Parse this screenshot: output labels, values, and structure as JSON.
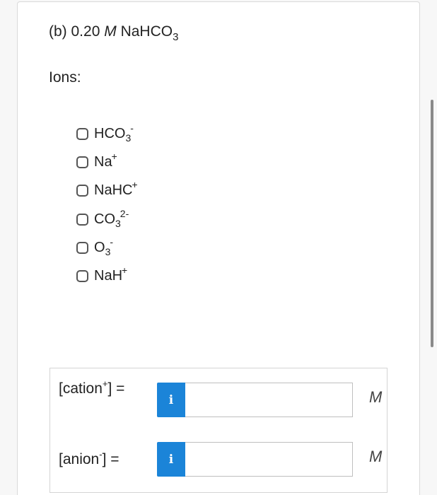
{
  "question": {
    "prefix": "(b) 0.20",
    "molar_symbol": "M",
    "compound": {
      "main": "NaHCO",
      "subscript": "3"
    }
  },
  "ions_heading": "Ions:",
  "options": [
    {
      "main": "HCO",
      "sub": "3",
      "sup": "-"
    },
    {
      "main": "Na",
      "sub": "",
      "sup": "+"
    },
    {
      "main": "NaHC",
      "sub": "",
      "sup": "+"
    },
    {
      "main": "CO",
      "sub": "3",
      "sup": "2-"
    },
    {
      "main": "O",
      "sub": "3",
      "sup": "-"
    },
    {
      "main": "NaH",
      "sub": "",
      "sup": "+"
    }
  ],
  "answers": {
    "cation": {
      "label_before": "[cation",
      "label_sup": "+",
      "label_after": "] =",
      "info_icon": "i",
      "value": "",
      "unit": "M"
    },
    "anion": {
      "label_before": "[anion",
      "label_sup": "-",
      "label_after": "] =",
      "info_icon": "i",
      "value": "",
      "unit": "M"
    }
  }
}
